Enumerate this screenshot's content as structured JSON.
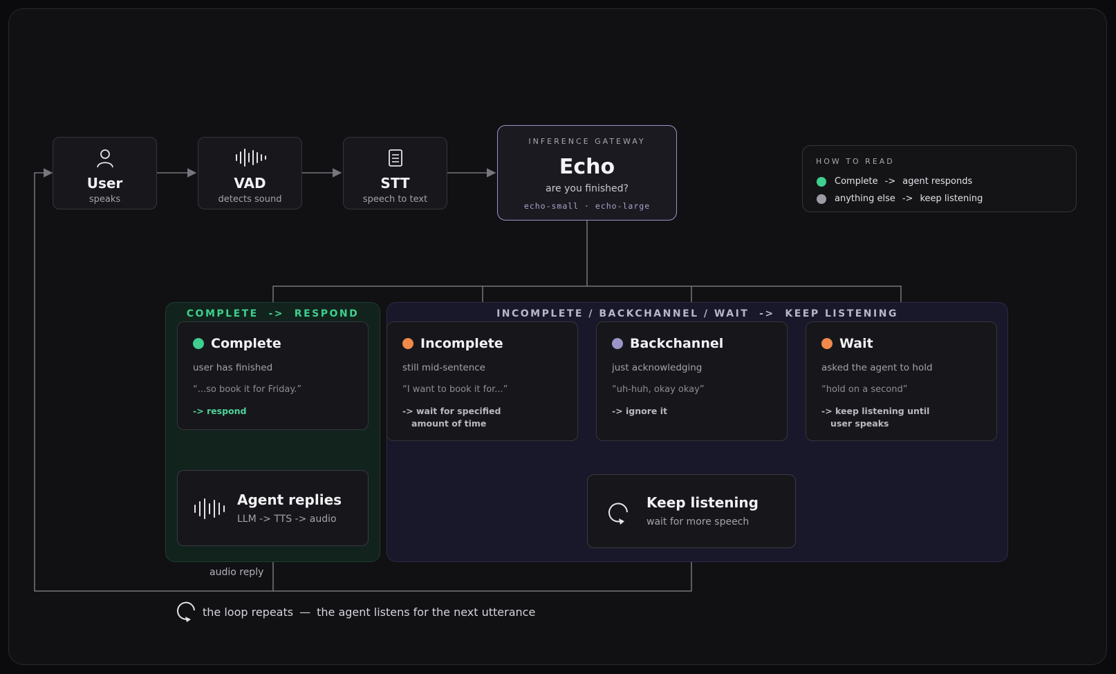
{
  "pipeline": [
    {
      "title": "User",
      "subtitle": "speaks",
      "icon": "person-icon"
    },
    {
      "title": "VAD",
      "subtitle": "detects sound",
      "icon": "waveform-icon"
    },
    {
      "title": "STT",
      "subtitle": "speech to text",
      "icon": "document-icon"
    }
  ],
  "gateway": {
    "caption": "INFERENCE GATEWAY",
    "title": "Echo",
    "subtitle": "are you finished?",
    "models": "echo-small · echo-large"
  },
  "legend": {
    "caption": "HOW TO READ",
    "rows": [
      {
        "state": "Complete",
        "arrow": "->",
        "result": "agent responds",
        "color": "#3fcf8e"
      },
      {
        "state": "anything else",
        "arrow": "->",
        "result": "keep listening",
        "color": "#9c9ca4"
      }
    ]
  },
  "regions": {
    "complete_label": "COMPLETE  ->  RESPOND",
    "keep_label": "INCOMPLETE / BACKCHANNEL / WAIT  ->  KEEP LISTENING"
  },
  "states": [
    {
      "title": "Complete",
      "description": "user has finished",
      "example": "“...so book it for Friday.”",
      "action": "-> respond",
      "color": "#3fcf8e"
    },
    {
      "title": "Incomplete",
      "description": "still mid-sentence",
      "example": "“I want to book it for...”",
      "action": "-> wait for specified\n   amount of time",
      "color": "#f08a4b"
    },
    {
      "title": "Backchannel",
      "description": "just acknowledging",
      "example": "“uh-huh, okay okay”",
      "action": "-> ignore it",
      "color": "#9a95c9"
    },
    {
      "title": "Wait",
      "description": "asked the agent to hold",
      "example": "“hold on a second”",
      "action": "-> keep listening until\n   user speaks",
      "color": "#f08a4b"
    }
  ],
  "agent": {
    "title": "Agent replies",
    "subtitle": "LLM -> TTS -> audio"
  },
  "keep": {
    "title": "Keep listening",
    "subtitle": "wait for more speech"
  },
  "audio_reply": "audio reply",
  "footer": {
    "text": "the loop repeats",
    "dash": "—",
    "detail": "the agent listens for the next utterance"
  },
  "colors": {
    "accent_green": "#3fcf8e",
    "accent_purple": "#9b95c8",
    "line": "#76767d"
  }
}
